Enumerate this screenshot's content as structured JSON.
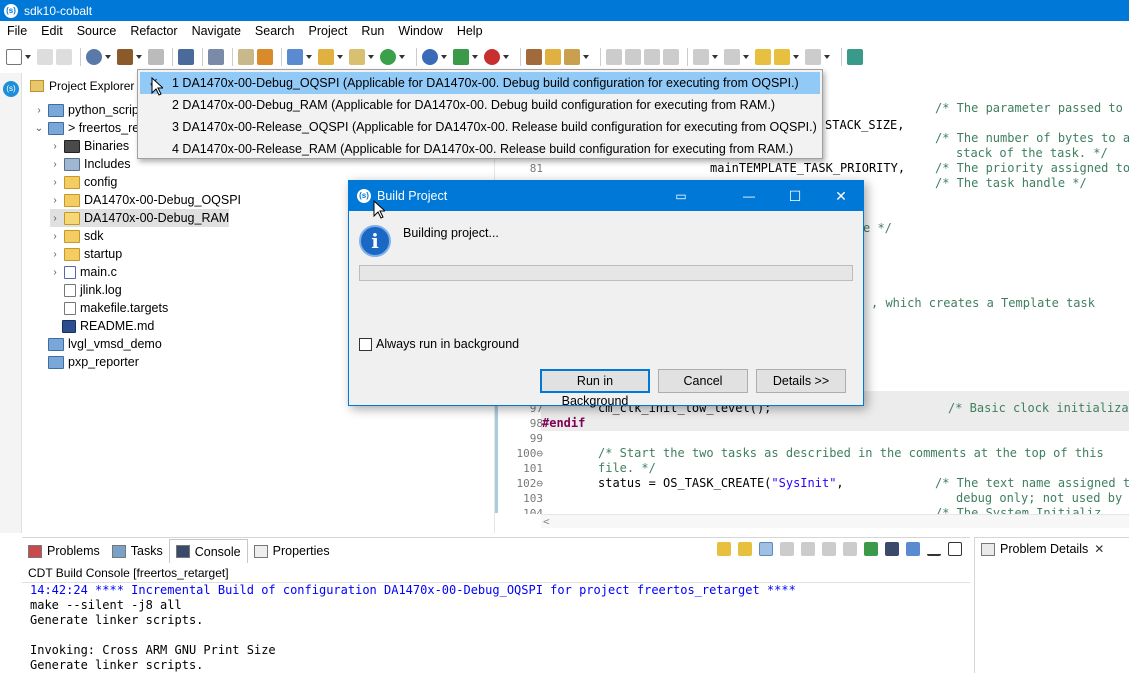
{
  "window": {
    "title": "sdk10-cobalt"
  },
  "menubar": [
    "File",
    "Edit",
    "Source",
    "Refactor",
    "Navigate",
    "Search",
    "Project",
    "Run",
    "Window",
    "Help"
  ],
  "project_explorer": {
    "title": "Project Explorer",
    "items": [
      {
        "label": "python_scrip",
        "icon": "project-icon",
        "twisty": "›"
      },
      {
        "label": "> freertos_re",
        "icon": "project-icon",
        "twisty": "⌄"
      },
      {
        "label": "Binaries",
        "icon": "binaries-icon",
        "twisty": "›"
      },
      {
        "label": "Includes",
        "icon": "includes-icon",
        "twisty": "›"
      },
      {
        "label": "config",
        "icon": "folder-icon",
        "twisty": "›"
      },
      {
        "label": "DA1470x-00-Debug_OQSPI",
        "icon": "folder-icon",
        "twisty": "›"
      },
      {
        "label": "DA1470x-00-Debug_RAM",
        "icon": "folder-icon",
        "twisty": "›"
      },
      {
        "label": "sdk",
        "icon": "folder-icon",
        "twisty": "›"
      },
      {
        "label": "startup",
        "icon": "folder-icon",
        "twisty": "›"
      },
      {
        "label": "main.c",
        "icon": "c-file-icon",
        "twisty": "›"
      },
      {
        "label": "jlink.log",
        "icon": "file-icon",
        "twisty": ""
      },
      {
        "label": "makefile.targets",
        "icon": "file-icon",
        "twisty": ""
      },
      {
        "label": "README.md",
        "icon": "markdown-icon",
        "twisty": ""
      },
      {
        "label": "lvgl_vmsd_demo",
        "icon": "project-closed-icon",
        "twisty": ""
      },
      {
        "label": "pxp_reporter",
        "icon": "project-closed-icon",
        "twisty": ""
      }
    ]
  },
  "config_menu": {
    "items": [
      "1 DA1470x-00-Debug_OQSPI (Applicable for DA1470x-00. Debug build configuration for executing from OQSPI.)",
      "2 DA1470x-00-Debug_RAM (Applicable for DA1470x-00. Debug build configuration for executing from RAM.)",
      "3 DA1470x-00-Release_OQSPI (Applicable for DA1470x-00. Release build configuration for executing from OQSPI.)",
      "4 DA1470x-00-Release_RAM (Applicable for DA1470x-00. Release build configuration for executing from RAM.)"
    ],
    "checked": "✓"
  },
  "editor": {
    "fragments": {
      "c1": "/* The parameter passed to t",
      "c2": "STACK_SIZE,",
      "c3": "/* The number of bytes to al",
      "c4": "stack of the task. */",
      "ln81": "81",
      "c5": "mainTEMPLATE_TASK_PRIORITY,",
      "c6": "/* The priority assigned to",
      "c7": "/* The task handle */",
      "c8": "e */",
      "c9": ", which creates a Template task",
      "ln97": "97",
      "c10": "cm_clk_init_low_level();",
      "c11": "/* Basic clock initializat",
      "ln98": "98",
      "c12": "#endif",
      "ln99": "99",
      "ln100": "100⊖",
      "c13": "/* Start the two tasks as described in the comments at the top of this",
      "ln101": "101",
      "c14": "file. */",
      "ln102": "102⊖",
      "c15a": "status = OS_TASK_CREATE(",
      "c15b": "\"SysInit\"",
      "c15c": ",",
      "c16": "/* The text name assigned to",
      "ln103": "103",
      "c17": "debug only; not used by t",
      "ln104": "104",
      "c18": "/* The System Initializ",
      "hscroll": "<"
    }
  },
  "bottom_panel": {
    "tabs": [
      "Problems",
      "Tasks",
      "Console",
      "Properties"
    ],
    "console_name": "CDT Build Console [freertos_retarget]",
    "lines": [
      "14:42:24 **** Incremental Build of configuration DA1470x-00-Debug_OQSPI for project freertos_retarget ****",
      "make --silent -j8 all",
      "Generate linker scripts.",
      "",
      "Invoking: Cross ARM GNU Print Size",
      "Generate linker scripts."
    ]
  },
  "problem_panel": {
    "tab": "Problem Details",
    "close": "✕"
  },
  "build_dialog": {
    "title": "Build Project",
    "message": "Building project...",
    "progress": 0,
    "checkbox_label": "Always run in background",
    "buttons": {
      "run_background": "Run in Background",
      "cancel": "Cancel",
      "details": "Details >>"
    },
    "window_buttons": {
      "minimize": "—",
      "maximize": "☐",
      "close": "✕"
    }
  },
  "colors": {
    "accent": "#0078d7",
    "menu_highlight": "#91c9f7",
    "comment": "#3f7f5f",
    "keyword": "#7f0055",
    "string": "#2a00ff"
  }
}
